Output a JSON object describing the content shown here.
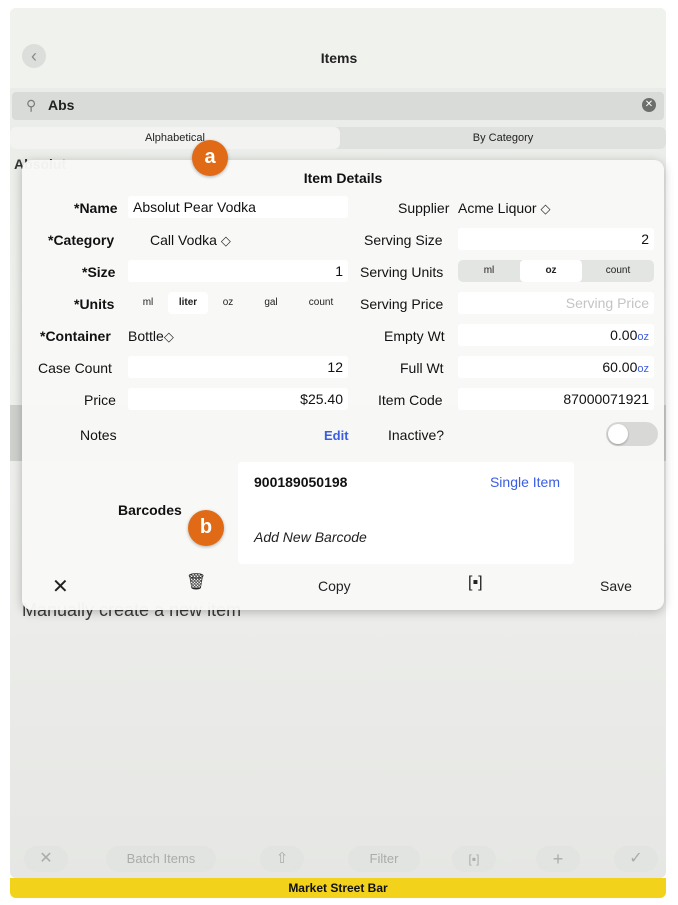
{
  "nav": {
    "title": "Items",
    "back_icon": "chevron-left-icon"
  },
  "search": {
    "value": "Abs",
    "icon": "search-icon",
    "clear_icon": "clear-icon"
  },
  "segment": {
    "options": [
      "Alphabetical",
      "By Category"
    ],
    "selected": "Alphabetical"
  },
  "list": {
    "section_header": "Absolut",
    "manual_text": "Manually create a new item"
  },
  "dialog": {
    "title": "Item Details",
    "name": {
      "label": "*Name",
      "value": "Absolut Pear Vodka"
    },
    "category": {
      "label": "*Category",
      "value": "Call Vodka"
    },
    "size": {
      "label": "*Size",
      "value": "1"
    },
    "units": {
      "label": "*Units",
      "options": [
        "ml",
        "liter",
        "oz",
        "gal",
        "count"
      ],
      "selected": "liter"
    },
    "container": {
      "label": "*Container",
      "value": "Bottle"
    },
    "case_count": {
      "label": "Case Count",
      "value": "12"
    },
    "price": {
      "label": "Price",
      "value": "$25.40"
    },
    "notes": {
      "label": "Notes",
      "edit_label": "Edit"
    },
    "supplier": {
      "label": "Supplier",
      "value": "Acme Liquor"
    },
    "serving_size": {
      "label": "Serving Size",
      "value": "2"
    },
    "serving_units": {
      "label": "Serving Units",
      "options": [
        "ml",
        "oz",
        "count"
      ],
      "selected": "oz"
    },
    "serving_price": {
      "label": "Serving Price",
      "placeholder": "Serving Price"
    },
    "empty_wt": {
      "label": "Empty Wt",
      "value": "0.00",
      "unit": "oz"
    },
    "full_wt": {
      "label": "Full Wt",
      "value": "60.00",
      "unit": "oz"
    },
    "item_code": {
      "label": "Item Code",
      "value": "87000071921"
    },
    "inactive": {
      "label": "Inactive?",
      "on": false
    },
    "barcodes": {
      "label": "Barcodes",
      "items": [
        {
          "code": "900189050198",
          "type": "Single Item"
        }
      ],
      "add_label": "Add New Barcode"
    },
    "toolbar": {
      "copy_label": "Copy",
      "save_label": "Save"
    }
  },
  "badges": {
    "a": "a",
    "b": "b"
  },
  "bottom_bar": {
    "batch_label": "Batch Items",
    "filter_label": "Filter"
  },
  "footer": {
    "venue": "Market Street Bar"
  },
  "colors": {
    "accent": "#3b5de2",
    "badge": "#e06a16",
    "footer": "#f2d21a"
  }
}
